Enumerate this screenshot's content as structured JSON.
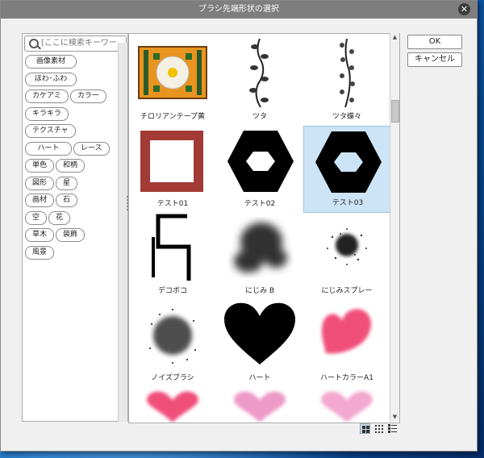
{
  "window": {
    "title": "ブラシ先端形状の選択",
    "close_glyph": "✕"
  },
  "search": {
    "placeholder": "[ここに検索キーワー…"
  },
  "tags": [
    [
      "画像素材"
    ],
    [
      "ほわ･ふわ"
    ],
    [
      "カケアミ",
      "カラー"
    ],
    [
      "キラキラ"
    ],
    [
      "テクスチャ"
    ],
    [
      "ハート",
      "レース"
    ],
    [
      "単色",
      "和柄"
    ],
    [
      "図形",
      "星"
    ],
    [
      "画材",
      "石"
    ],
    [
      "空",
      "花"
    ],
    [
      "草木",
      "装飾"
    ],
    [
      "風景"
    ]
  ],
  "brushes": [
    {
      "label": "チロリアンテープ黄",
      "icon": "tyrolean-tape-yellow"
    },
    {
      "label": "ツタ",
      "icon": "ivy-vine"
    },
    {
      "label": "ツタ蝶々",
      "icon": "ivy-butterfly"
    },
    {
      "label": "テスト01",
      "icon": "square-frame"
    },
    {
      "label": "テスト02",
      "icon": "hexagon-nut"
    },
    {
      "label": "テスト03",
      "icon": "hexagon-nut",
      "selected": true
    },
    {
      "label": "デコボコ",
      "icon": "bumpy-line"
    },
    {
      "label": "にじみ B",
      "icon": "blur-blob"
    },
    {
      "label": "にじみスプレー",
      "icon": "blur-spray"
    },
    {
      "label": "ノイズブラシ",
      "icon": "noise-brush"
    },
    {
      "label": "ハート",
      "icon": "heart-black"
    },
    {
      "label": "ハートカラーA1",
      "icon": "heart-pink"
    }
  ],
  "buttons": {
    "ok": "OK",
    "cancel": "キャンセル"
  },
  "colors": {
    "selected_bg": "#cde4f7",
    "heart_pink": "#f0507a",
    "frame_red": "#a23a36",
    "tape_orange": "#e8941e"
  }
}
